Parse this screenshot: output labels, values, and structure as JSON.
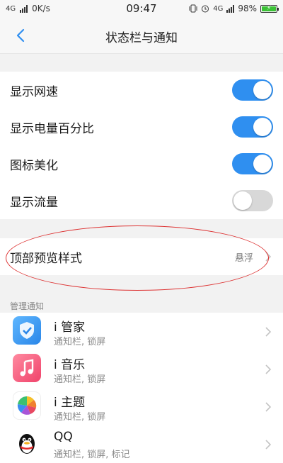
{
  "status_bar": {
    "network_left": "4G",
    "speed": "0K/s",
    "time": "09:47",
    "network_right": "4G",
    "battery": "98%"
  },
  "header": {
    "title": "状态栏与通知"
  },
  "toggles": [
    {
      "label": "显示网速",
      "state": "on"
    },
    {
      "label": "显示电量百分比",
      "state": "on"
    },
    {
      "label": "图标美化",
      "state": "on"
    },
    {
      "label": "显示流量",
      "state": "off"
    }
  ],
  "preview": {
    "label": "顶部预览样式",
    "value": "悬浮"
  },
  "notifications": {
    "section_label": "管理通知",
    "apps": [
      {
        "name": "i 管家",
        "subtitle": "通知栏, 锁屏",
        "icon": "shield-check-icon"
      },
      {
        "name": "i 音乐",
        "subtitle": "通知栏, 锁屏",
        "icon": "music-note-icon"
      },
      {
        "name": "i 主题",
        "subtitle": "通知栏, 锁屏",
        "icon": "pinwheel-icon"
      },
      {
        "name": "QQ",
        "subtitle": "通知栏, 锁屏, 标记",
        "icon": "penguin-icon"
      }
    ]
  },
  "colors": {
    "toggle_on": "#2f8ff0",
    "toggle_off": "#d8d8d8",
    "accent": "#2f8ff0"
  }
}
